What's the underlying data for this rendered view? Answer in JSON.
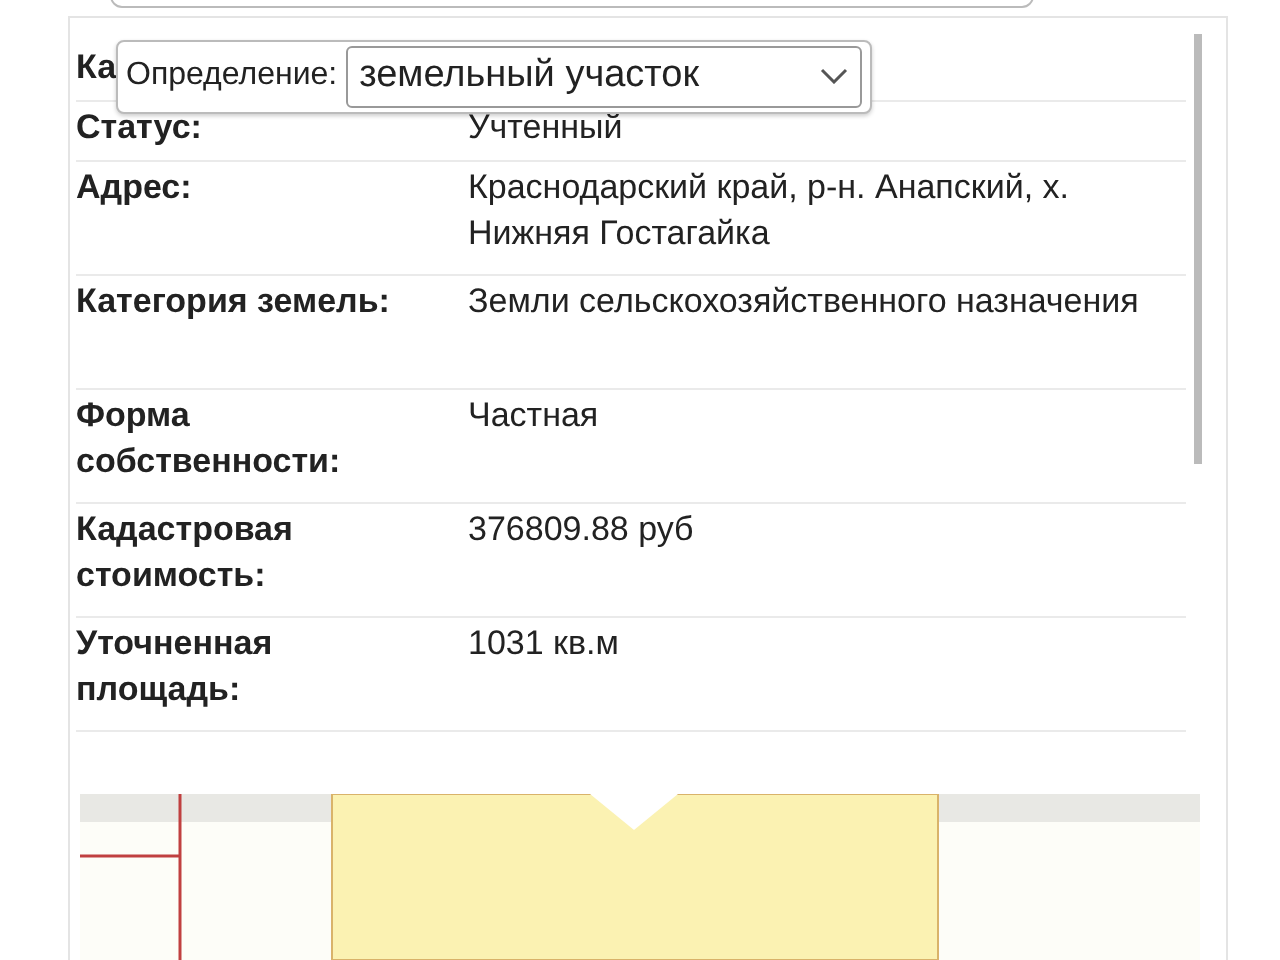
{
  "definition": {
    "label": "Определение:",
    "value": "земельный участок"
  },
  "rows": [
    {
      "label": "Ка",
      "value": ""
    },
    {
      "label": "Статус:",
      "value": "Учтенный"
    },
    {
      "label": "Адрес:",
      "value": "Краснодарский край, р-н. Анапский, х. Нижняя Гостагайка"
    },
    {
      "label": "Категория земель:",
      "value": "Земли сельскохозяйственного назначения"
    },
    {
      "label": "Форма собственности:",
      "value": "Частная"
    },
    {
      "label": "Кадастровая стоимость:",
      "value": "376809.88 руб"
    },
    {
      "label": "Уточненная площадь:",
      "value": "1031 кв.м"
    }
  ]
}
